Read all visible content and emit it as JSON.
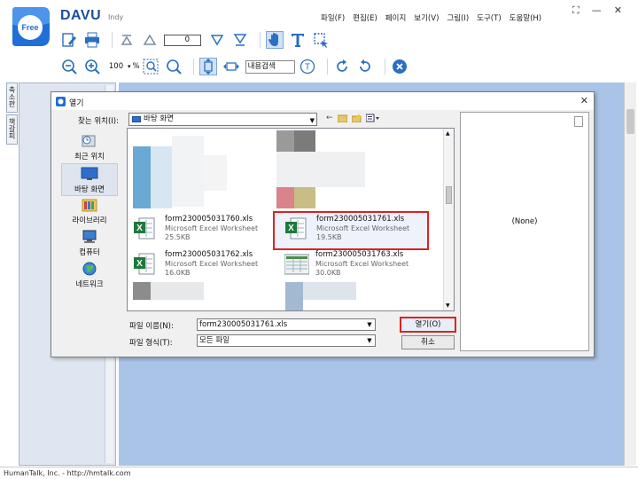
{
  "app": {
    "logo_text": "Free",
    "brand": "DAVU",
    "brand_sub": "Indy",
    "menu": [
      "파일(F)",
      "편집(E)",
      "페이지",
      "보기(V)",
      "그림(I)",
      "도구(T)",
      "도움말(H)"
    ],
    "page_number": "0",
    "zoom_value": "100",
    "zoom_unit": "%",
    "search_label": "내용검색",
    "side_tabs": [
      "축소판",
      "책갈피"
    ],
    "status": "HumanTalk, Inc. - http://hmtalk.com"
  },
  "dialog": {
    "title": "열기",
    "lookin_label": "찾는 위치(I):",
    "lookin_value": "바탕 화면",
    "places": [
      "최근 위치",
      "바탕 화면",
      "라이브러리",
      "컴퓨터",
      "네트워크"
    ],
    "files": [
      {
        "name": "form230005031760.xls",
        "type": "Microsoft Excel Worksheet",
        "size": "25.5KB"
      },
      {
        "name": "form230005031761.xls",
        "type": "Microsoft Excel Worksheet",
        "size": "19.5KB"
      },
      {
        "name": "form230005031762.xls",
        "type": "Microsoft Excel Worksheet",
        "size": "16.0KB"
      },
      {
        "name": "form230005031763.xls",
        "type": "Microsoft Excel Worksheet",
        "size": "30.0KB"
      }
    ],
    "preview_text": "(None)",
    "filename_label": "파일 이름(N):",
    "filename_value": "form230005031761.xls",
    "filetype_label": "파일 형식(T):",
    "filetype_value": "모든 파일",
    "open_label": "열기(O)",
    "cancel_label": "취소"
  },
  "colors": {
    "brand": "#1b4f9c",
    "canvas": "#a9c4e7",
    "highlight": "#e02020",
    "excel_green": "#1d7a3a"
  }
}
